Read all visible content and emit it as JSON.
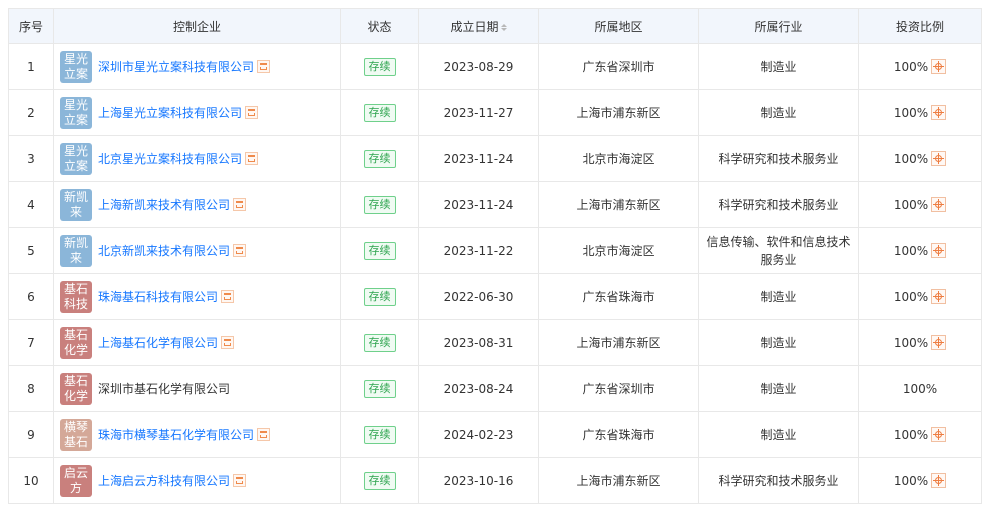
{
  "headers": {
    "seq": "序号",
    "company": "控制企业",
    "status": "状态",
    "date": "成立日期",
    "region": "所属地区",
    "industry": "所属行业",
    "ratio": "投资比例"
  },
  "colors": {
    "logo_blue": "#8bb6d9",
    "logo_red": "#c9807d",
    "logo_tan": "#d4a898",
    "link": "#1677ff",
    "status_green": "#2da44e",
    "header_bg": "#f2f6fc"
  },
  "rows": [
    {
      "seq": "1",
      "logo": "星光立案",
      "logo_color": "#8bb6d9",
      "name": "深圳市星光立案科技有限公司",
      "link": true,
      "tag": true,
      "status": "存续",
      "date": "2023-08-29",
      "region": "广东省深圳市",
      "industry": "制造业",
      "ratio": "100%",
      "ratio_icon": true
    },
    {
      "seq": "2",
      "logo": "星光立案",
      "logo_color": "#8bb6d9",
      "name": "上海星光立案科技有限公司",
      "link": true,
      "tag": true,
      "status": "存续",
      "date": "2023-11-27",
      "region": "上海市浦东新区",
      "industry": "制造业",
      "ratio": "100%",
      "ratio_icon": true
    },
    {
      "seq": "3",
      "logo": "星光立案",
      "logo_color": "#8bb6d9",
      "name": "北京星光立案科技有限公司",
      "link": true,
      "tag": true,
      "status": "存续",
      "date": "2023-11-24",
      "region": "北京市海淀区",
      "industry": "科学研究和技术服务业",
      "ratio": "100%",
      "ratio_icon": true
    },
    {
      "seq": "4",
      "logo": "新凯来",
      "logo_color": "#8bb6d9",
      "name": "上海新凯来技术有限公司",
      "link": true,
      "tag": true,
      "status": "存续",
      "date": "2023-11-24",
      "region": "上海市浦东新区",
      "industry": "科学研究和技术服务业",
      "ratio": "100%",
      "ratio_icon": true
    },
    {
      "seq": "5",
      "logo": "新凯来",
      "logo_color": "#8bb6d9",
      "name": "北京新凯来技术有限公司",
      "link": true,
      "tag": true,
      "status": "存续",
      "date": "2023-11-22",
      "region": "北京市海淀区",
      "industry": "信息传输、软件和信息技术服务业",
      "ratio": "100%",
      "ratio_icon": true
    },
    {
      "seq": "6",
      "logo": "基石科技",
      "logo_color": "#c9807d",
      "name": "珠海基石科技有限公司",
      "link": true,
      "tag": true,
      "status": "存续",
      "date": "2022-06-30",
      "region": "广东省珠海市",
      "industry": "制造业",
      "ratio": "100%",
      "ratio_icon": true
    },
    {
      "seq": "7",
      "logo": "基石化学",
      "logo_color": "#c9807d",
      "name": "上海基石化学有限公司",
      "link": true,
      "tag": true,
      "status": "存续",
      "date": "2023-08-31",
      "region": "上海市浦东新区",
      "industry": "制造业",
      "ratio": "100%",
      "ratio_icon": true
    },
    {
      "seq": "8",
      "logo": "基石化学",
      "logo_color": "#c9807d",
      "name": "深圳市基石化学有限公司",
      "link": false,
      "tag": false,
      "status": "存续",
      "date": "2023-08-24",
      "region": "广东省深圳市",
      "industry": "制造业",
      "ratio": "100%",
      "ratio_icon": false
    },
    {
      "seq": "9",
      "logo": "横琴基石",
      "logo_color": "#d4a898",
      "name": "珠海市横琴基石化学有限公司",
      "link": true,
      "tag": true,
      "status": "存续",
      "date": "2024-02-23",
      "region": "广东省珠海市",
      "industry": "制造业",
      "ratio": "100%",
      "ratio_icon": true
    },
    {
      "seq": "10",
      "logo": "启云方",
      "logo_color": "#c9807d",
      "name": "上海启云方科技有限公司",
      "link": true,
      "tag": true,
      "status": "存续",
      "date": "2023-10-16",
      "region": "上海市浦东新区",
      "industry": "科学研究和技术服务业",
      "ratio": "100%",
      "ratio_icon": true
    }
  ]
}
